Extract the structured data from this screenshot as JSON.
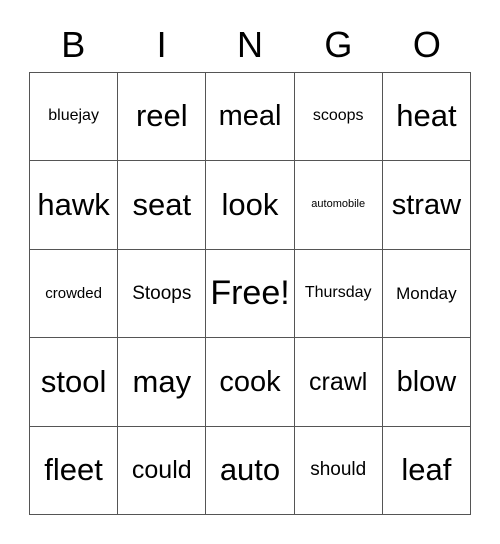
{
  "card": {
    "title": "BINGO",
    "border_color": "#555555",
    "text_color": "#000000",
    "background_color": "#ffffff"
  },
  "header": {
    "letters": [
      "B",
      "I",
      "N",
      "G",
      "O"
    ]
  },
  "grid": {
    "rows": 5,
    "columns": 5,
    "free_space": "Free!",
    "free_space_position": {
      "row": 3,
      "column": 3
    },
    "cells": [
      [
        {
          "text": "bluejay",
          "size": "fs-sm"
        },
        {
          "text": "reel",
          "size": "fs-xxl"
        },
        {
          "text": "meal",
          "size": "fs-xl"
        },
        {
          "text": "scoops",
          "size": "fs-sm"
        },
        {
          "text": "heat",
          "size": "fs-xxl"
        }
      ],
      [
        {
          "text": "hawk",
          "size": "fs-xxl"
        },
        {
          "text": "seat",
          "size": "fs-xxl"
        },
        {
          "text": "look",
          "size": "fs-xxl"
        },
        {
          "text": "automobile",
          "size": "fs-xs"
        },
        {
          "text": "straw",
          "size": "fs-xl"
        }
      ],
      [
        {
          "text": "crowded",
          "size": "fs-s"
        },
        {
          "text": "Stoops",
          "size": "fs-ml"
        },
        {
          "text": "Free!",
          "size": "fs-max"
        },
        {
          "text": "Thursday",
          "size": "fs-sm"
        },
        {
          "text": "Monday",
          "size": "fs-m"
        }
      ],
      [
        {
          "text": "stool",
          "size": "fs-xxl"
        },
        {
          "text": "may",
          "size": "fs-xxl"
        },
        {
          "text": "cook",
          "size": "fs-xl"
        },
        {
          "text": "crawl",
          "size": "fs-l"
        },
        {
          "text": "blow",
          "size": "fs-xl"
        }
      ],
      [
        {
          "text": "fleet",
          "size": "fs-xxl"
        },
        {
          "text": "could",
          "size": "fs-l"
        },
        {
          "text": "auto",
          "size": "fs-xxl"
        },
        {
          "text": "should",
          "size": "fs-ml"
        },
        {
          "text": "leaf",
          "size": "fs-xxl"
        }
      ]
    ]
  }
}
